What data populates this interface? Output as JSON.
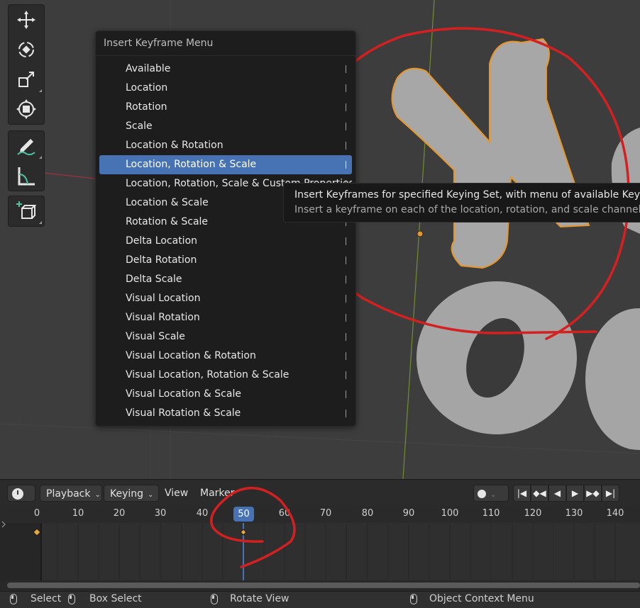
{
  "menu": {
    "title": "Insert Keyframe Menu",
    "items": [
      {
        "label": "Available"
      },
      {
        "label": "Location"
      },
      {
        "label": "Rotation"
      },
      {
        "label": "Scale"
      },
      {
        "label": "Location & Rotation"
      },
      {
        "label": "Location, Rotation & Scale",
        "highlighted": true
      },
      {
        "label": "Location, Rotation, Scale & Custom Properties"
      },
      {
        "label": "Location & Scale"
      },
      {
        "label": "Rotation & Scale"
      },
      {
        "label": "Delta Location"
      },
      {
        "label": "Delta Rotation"
      },
      {
        "label": "Delta Scale"
      },
      {
        "label": "Visual Location"
      },
      {
        "label": "Visual Rotation"
      },
      {
        "label": "Visual Scale"
      },
      {
        "label": "Visual Location & Rotation"
      },
      {
        "label": "Visual Location, Rotation & Scale"
      },
      {
        "label": "Visual Location & Scale"
      },
      {
        "label": "Visual Rotation & Scale"
      }
    ]
  },
  "tooltip": {
    "line1": "Insert Keyframes for specified Keying Set, with menu of available Keying Sets",
    "line2": "Insert a keyframe on each of the location, rotation, and scale channels"
  },
  "toolbar": {
    "tools": [
      "move-icon",
      "rotate-icon",
      "scale-icon",
      "transform-icon",
      "annotate-icon",
      "measure-icon",
      "add-cube-icon"
    ]
  },
  "timeline": {
    "editor_icon": "clock-icon",
    "playback_label": "Playback",
    "keying_label": "Keying",
    "view_label": "View",
    "marker_label": "Marker",
    "current_frame": "50",
    "ticks": [
      "0",
      "10",
      "20",
      "30",
      "40",
      "60",
      "70",
      "80",
      "90",
      "100",
      "110",
      "120",
      "130",
      "140"
    ],
    "keyframes": [
      0,
      50
    ],
    "playback_buttons": [
      "jump-start-icon",
      "prev-keyframe-icon",
      "play-reverse-icon",
      "play-icon",
      "next-keyframe-icon",
      "jump-end-icon"
    ]
  },
  "statusbar": {
    "select": "Select",
    "box_select": "Box Select",
    "rotate_view": "Rotate View",
    "context_menu": "Object Context Menu"
  },
  "colors": {
    "highlight": "#4772b3",
    "annotation": "#d42020",
    "selection_outline": "#e8962a",
    "keyframe": "#e8a838"
  }
}
